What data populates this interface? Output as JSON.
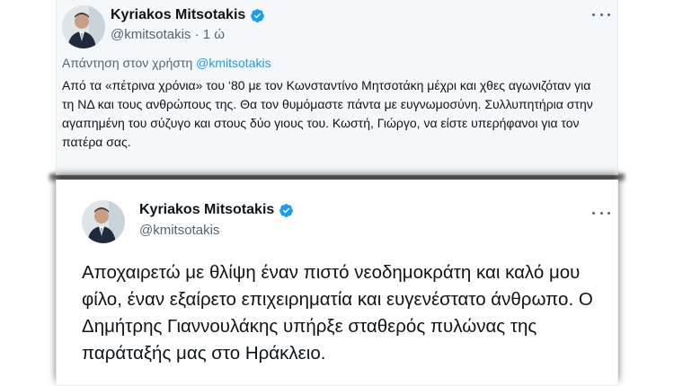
{
  "top_tweet": {
    "author_name": "Kyriakos Mitsotakis",
    "author_handle": "@kmitsotakis",
    "separator": "·",
    "time": "1 ώ",
    "reply_prefix": "Απάντηση στον χρήστη",
    "reply_handle": "@kmitsotakis",
    "text": "Από τα «πέτρινα χρόνια» του ‘80 με τον Κωνσταντίνο Μητσοτάκη μέχρι και χθες αγωνιζόταν για τη ΝΔ και τους ανθρώπους της. Θα τον θυμόμαστε πάντα με ευγνωμοσύνη. Συλλυπητήρια στην αγαπημένη του σύζυγο και στους δύο γιους του. Κωστή, Γιώργο, να είστε υπερήφανοι για τον πατέρα σας."
  },
  "bottom_tweet": {
    "author_name": "Kyriakos Mitsotakis",
    "author_handle": "@kmitsotakis",
    "text": "Αποχαιρετώ με θλίψη έναν πιστό νεοδημοκράτη και καλό μου φίλο, έναν εξαίρετο επιχειρηματία και ευγενέστατο άνθρωπο. Ο Δημήτρης Γιαννουλάκης υπήρξε σταθερός πυλώνας της παράταξής μας στο Ηράκλειο."
  },
  "icons": {
    "verified": "verified-badge-icon",
    "more": "more-options-icon",
    "avatar": "profile-avatar"
  },
  "colors": {
    "accent": "#1d9bf0",
    "text": "#0f1419",
    "secondary_text": "#536471"
  }
}
